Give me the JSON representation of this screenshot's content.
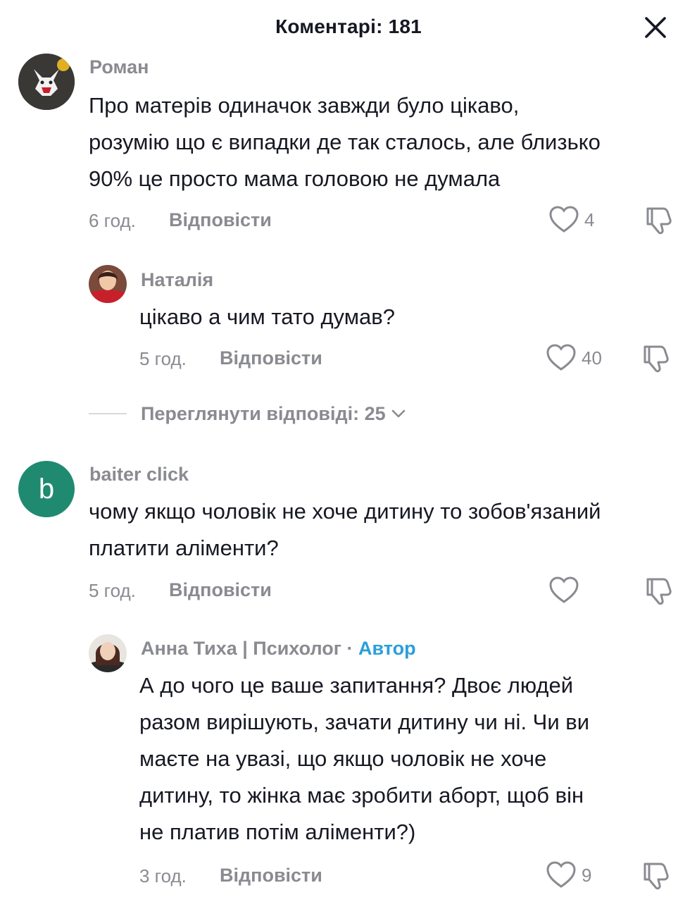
{
  "header": {
    "title": "Коментарі: 181"
  },
  "comments": [
    {
      "username": "Роман",
      "text_lines": [
        "Про матерів одиначок завжди було цікаво,",
        "розумію що є випадки де так сталось, але близько",
        "90% це просто мама головою не думала"
      ],
      "time": "6 год.",
      "reply_label": "Відповісти",
      "likes": "4"
    },
    {
      "username": "Наталія",
      "text_lines": [
        "цікаво а чим тато думав?"
      ],
      "time": "5 год.",
      "reply_label": "Відповісти",
      "likes": "40"
    },
    {
      "username": "baiter click",
      "avatar_letter": "b",
      "text_lines": [
        "чому якщо чоловік не хоче дитину то зобов'язаний",
        "платити аліменти?"
      ],
      "time": "5 год.",
      "reply_label": "Відповісти",
      "likes": ""
    },
    {
      "username": "Анна Тиха | Психолог",
      "author_separator": "·",
      "author_label": "Автор",
      "text_lines": [
        "А до чого це ваше запитання? Двоє людей",
        "разом вирішують, зачати дитину чи ні. Чи ви",
        "маєте на увазі, що якщо чоловік не хоче",
        "дитину, то жінка має зробити аборт, щоб він",
        "не платив потім аліменти?)"
      ],
      "time": "3 год.",
      "reply_label": "Відповісти",
      "likes": "9"
    }
  ],
  "view_replies_label": "Переглянути відповіді: 25",
  "colors": {
    "text": "#161823",
    "muted": "#8a8b91",
    "author_accent": "#2b9fd8",
    "avatar_green": "#1f8a70"
  }
}
